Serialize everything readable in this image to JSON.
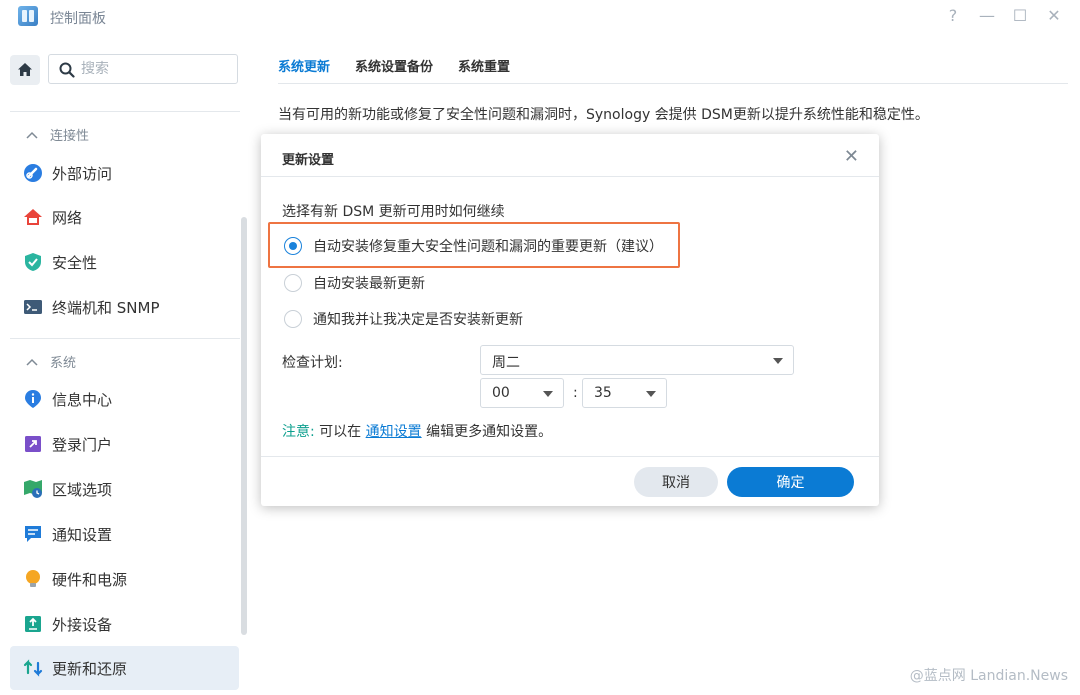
{
  "window": {
    "title": "控制面板",
    "controls": {
      "help": "?",
      "minimize": "—",
      "maximize": "☐",
      "close": "✕"
    }
  },
  "sidebar": {
    "search_placeholder": "搜索",
    "groups": [
      {
        "label": "连接性",
        "collapse_glyph": "^"
      },
      {
        "label": "系统",
        "collapse_glyph": "^"
      }
    ],
    "items": [
      {
        "label": "外部访问",
        "icon": "link-icon"
      },
      {
        "label": "网络",
        "icon": "house-network-icon"
      },
      {
        "label": "安全性",
        "icon": "shield-check-icon"
      },
      {
        "label": "终端机和 SNMP",
        "icon": "terminal-icon"
      },
      {
        "label": "信息中心",
        "icon": "info-icon"
      },
      {
        "label": "登录门户",
        "icon": "portal-arrow-icon"
      },
      {
        "label": "区域选项",
        "icon": "map-clock-icon"
      },
      {
        "label": "通知设置",
        "icon": "message-icon"
      },
      {
        "label": "硬件和电源",
        "icon": "bulb-icon"
      },
      {
        "label": "外接设备",
        "icon": "external-device-icon"
      },
      {
        "label": "更新和还原",
        "icon": "refresh-icon",
        "active": true
      }
    ]
  },
  "main": {
    "tabs": [
      {
        "label": "系统更新",
        "active": true
      },
      {
        "label": "系统设置备份"
      },
      {
        "label": "系统重置"
      }
    ],
    "description": "当有可用的新功能或修复了安全性问题和漏洞时，Synology 会提供 DSM更新以提升系统性能和稳定性。"
  },
  "dialog": {
    "title": "更新设置",
    "close_glyph": "✕",
    "question": "选择有新 DSM 更新可用时如何继续",
    "options": [
      {
        "label": "自动安装修复重大安全性问题和漏洞的重要更新（建议）",
        "checked": true
      },
      {
        "label": "自动安装最新更新",
        "checked": false
      },
      {
        "label": "通知我并让我决定是否安装新更新",
        "checked": false
      }
    ],
    "schedule_label": "检查计划:",
    "day_value": "周二",
    "hour_value": "00",
    "time_separator": ":",
    "minute_value": "35",
    "note_key": "注意:",
    "note_prefix": "可以在",
    "note_link": "通知设置",
    "note_suffix": "编辑更多通知设置。",
    "cancel_label": "取消",
    "ok_label": "确定"
  },
  "watermark": "@蓝点网 Landian.News",
  "colors": {
    "accent": "#0b7bd4",
    "highlight_border": "#ee7442",
    "note_key": "#0fa08f",
    "active_item_bg": "#e7eef6"
  }
}
